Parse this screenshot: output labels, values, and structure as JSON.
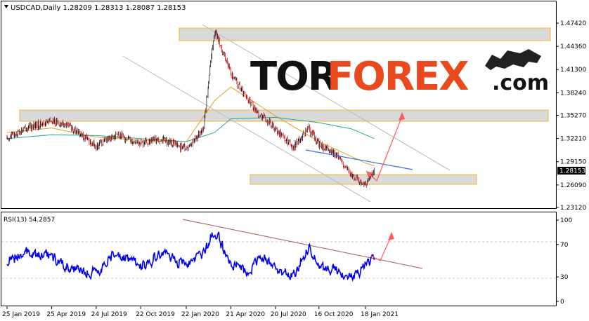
{
  "window": {
    "title": "USDCAD,Daily",
    "ohlc": [
      "1.28209",
      "1.28313",
      "1.28087",
      "1.28153"
    ]
  },
  "logo": {
    "part1": "TOR",
    "part2": "FOREX",
    "part3": ".com"
  },
  "colors": {
    "bull_candle": "#000000",
    "bear_candle": "#cc0000",
    "ma_fast": "#e0a020",
    "ma_slow": "#2aa198",
    "rsi_line": "#0000ee",
    "zone_fill": "#d9d9d9",
    "zone_border": "#f0b830",
    "channel": "#b0bcc8",
    "trend_blue": "#3a6fe0",
    "arrow": "#ff5a5a",
    "rsi_trend": "#b05050"
  },
  "chart_data": [
    {
      "type": "candlestick",
      "symbol": "USDCAD",
      "timeframe": "Daily",
      "ylim": [
        1.2312,
        1.4742
      ],
      "y_ticks": [
        "1.47420",
        "1.44360",
        "1.41300",
        "1.38240",
        "1.35270",
        "1.32210",
        "1.29150",
        "1.26090",
        "1.23120"
      ],
      "last_price_label": "1.28153",
      "x_ticks": [
        "25 Jan 2019",
        "25 Apr 2019",
        "24 Jul 2019",
        "22 Oct 2019",
        "22 Jan 2020",
        "21 Apr 2020",
        "20 Jul 2020",
        "16 Oct 2020",
        "18 Jan 2021"
      ],
      "series": [
        {
          "kind": "price",
          "x": [
            "2019-01-25",
            "2019-03-01",
            "2019-04-25",
            "2019-06-01",
            "2019-07-24",
            "2019-09-01",
            "2019-10-22",
            "2019-12-01",
            "2020-01-22",
            "2020-02-25",
            "2020-03-19",
            "2020-04-21",
            "2020-05-25",
            "2020-06-20",
            "2020-07-20",
            "2020-08-25",
            "2020-09-25",
            "2020-10-16",
            "2020-11-20",
            "2020-12-20",
            "2021-01-18",
            "2021-02-05"
          ],
          "values": [
            1.322,
            1.335,
            1.345,
            1.338,
            1.312,
            1.328,
            1.315,
            1.322,
            1.308,
            1.333,
            1.466,
            1.408,
            1.374,
            1.352,
            1.336,
            1.31,
            1.335,
            1.315,
            1.3,
            1.274,
            1.262,
            1.2815
          ]
        },
        {
          "kind": "moving_average",
          "x": [
            "2019-01-25",
            "2019-04-25",
            "2019-07-24",
            "2019-10-22",
            "2020-01-22",
            "2020-03-19",
            "2020-04-21",
            "2020-07-20",
            "2020-10-16",
            "2021-01-18",
            "2021-02-05"
          ],
          "values": [
            1.33,
            1.336,
            1.324,
            1.32,
            1.318,
            1.372,
            1.39,
            1.352,
            1.318,
            1.29,
            1.286
          ]
        },
        {
          "kind": "moving_average",
          "x": [
            "2019-01-25",
            "2019-04-25",
            "2019-07-24",
            "2019-10-22",
            "2020-01-22",
            "2020-03-19",
            "2020-04-21",
            "2020-07-20",
            "2020-10-16",
            "2020-12-20",
            "2021-02-05"
          ],
          "values": [
            1.322,
            1.327,
            1.326,
            1.322,
            1.318,
            1.33,
            1.348,
            1.35,
            1.343,
            1.335,
            1.322
          ]
        }
      ]
    },
    {
      "type": "line",
      "title": "RSI(13) 54.2857",
      "ylim": [
        0,
        100
      ],
      "y_ticks": [
        "100",
        "70",
        "30",
        "0"
      ],
      "series": [
        {
          "x": [
            "2019-01-25",
            "2019-03-01",
            "2019-04-25",
            "2019-06-01",
            "2019-07-24",
            "2019-09-01",
            "2019-10-22",
            "2019-12-01",
            "2020-01-22",
            "2020-02-25",
            "2020-03-19",
            "2020-04-21",
            "2020-05-25",
            "2020-06-20",
            "2020-07-20",
            "2020-08-25",
            "2020-09-25",
            "2020-10-16",
            "2020-11-20",
            "2020-12-20",
            "2021-01-18",
            "2021-02-05"
          ],
          "values": [
            48,
            62,
            55,
            40,
            35,
            60,
            42,
            58,
            45,
            60,
            88,
            45,
            35,
            55,
            40,
            32,
            65,
            45,
            38,
            28,
            45,
            54.29
          ]
        }
      ]
    }
  ]
}
